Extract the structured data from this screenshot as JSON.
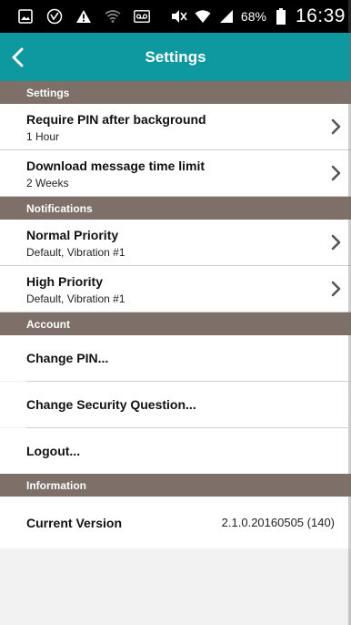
{
  "status_bar": {
    "battery_percent": "68%",
    "time": "16:39",
    "icons": [
      "gallery-icon",
      "voice-icon",
      "warning-icon",
      "wifi-icon",
      "voicemail-icon",
      "mute-icon",
      "wifi-icon",
      "signal-icon",
      "battery-icon"
    ]
  },
  "app_bar": {
    "title": "Settings",
    "back_icon": "chevron-left-icon",
    "color": "#0e98a0"
  },
  "sections": {
    "settings": {
      "header": "Settings",
      "items": [
        {
          "title": "Require PIN after background",
          "subtitle": "1 Hour"
        },
        {
          "title": "Download message time limit",
          "subtitle": "2 Weeks"
        }
      ]
    },
    "notifications": {
      "header": "Notifications",
      "items": [
        {
          "title": "Normal Priority",
          "subtitle": "Default, Vibration #1"
        },
        {
          "title": "High Priority",
          "subtitle": "Default, Vibration #1"
        }
      ]
    },
    "account": {
      "header": "Account",
      "items": [
        {
          "label": "Change PIN..."
        },
        {
          "label": "Change Security Question..."
        },
        {
          "label": "Logout..."
        }
      ]
    },
    "information": {
      "header": "Information",
      "current_version_label": "Current Version",
      "current_version_value": "2.1.0.20160505 (140)"
    }
  },
  "colors": {
    "section_header": "#7e7069",
    "app_bar": "#0e98a0",
    "background": "#f2f2f2"
  }
}
